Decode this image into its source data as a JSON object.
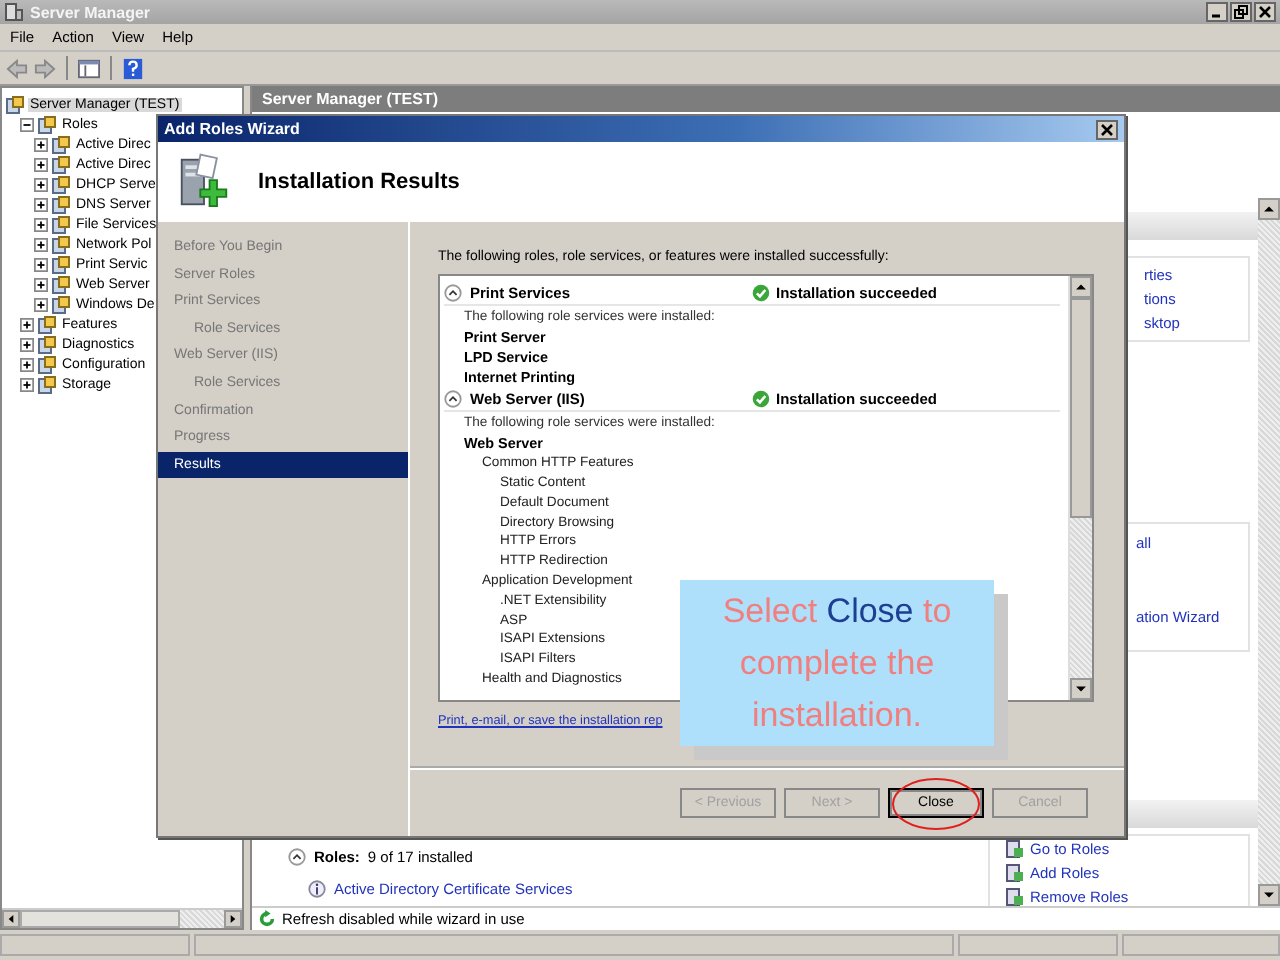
{
  "window": {
    "title": "Server Manager"
  },
  "menu": [
    "File",
    "Action",
    "View",
    "Help"
  ],
  "tree": [
    {
      "label": "Server Manager (TEST)",
      "selected": true,
      "children": [
        {
          "label": "Roles",
          "selected": false,
          "expanded": true,
          "children": [
            {
              "label": "Active Direc",
              "selected": false,
              "expanded": false
            },
            {
              "label": "Active Direc",
              "selected": false,
              "expanded": false
            },
            {
              "label": "DHCP Serve",
              "selected": false,
              "expanded": false
            },
            {
              "label": "DNS Server",
              "selected": false,
              "expanded": false
            },
            {
              "label": "File Services",
              "selected": false,
              "expanded": false
            },
            {
              "label": "Network Pol",
              "selected": false,
              "expanded": false
            },
            {
              "label": "Print Servic",
              "selected": false,
              "expanded": false
            },
            {
              "label": "Web Server",
              "selected": false,
              "expanded": false
            },
            {
              "label": "Windows De",
              "selected": false,
              "expanded": false
            }
          ]
        },
        {
          "label": "Features",
          "selected": false,
          "expanded": false
        },
        {
          "label": "Diagnostics",
          "selected": false,
          "expanded": false
        },
        {
          "label": "Configuration",
          "selected": false,
          "expanded": false
        },
        {
          "label": "Storage",
          "selected": false,
          "expanded": false
        }
      ]
    }
  ],
  "main_pane": {
    "header": "Server Manager (TEST)",
    "roles_summary": {
      "label": "Roles:",
      "value": "9 of 17 installed",
      "expanded": true
    },
    "role_link": "Active Directory Certificate Services",
    "tasks_upper": [
      "rties",
      "tions",
      "sktop"
    ],
    "tasks_middle": [
      "all",
      "ation Wizard"
    ],
    "tasks_lower": [
      "Go to Roles",
      "Add Roles",
      "Remove Roles"
    ],
    "status": "Refresh disabled while wizard in use"
  },
  "wizard": {
    "title": "Add Roles Wizard",
    "heading": "Installation Results",
    "steps": [
      {
        "label": "Before You Begin",
        "kind": "step",
        "selected": false
      },
      {
        "label": "Server Roles",
        "kind": "step",
        "selected": false
      },
      {
        "label": "Print Services",
        "kind": "step",
        "selected": false
      },
      {
        "label": "Role Services",
        "kind": "substep",
        "selected": false
      },
      {
        "label": "Web Server (IIS)",
        "kind": "step",
        "selected": false
      },
      {
        "label": "Role Services",
        "kind": "substep",
        "selected": false
      },
      {
        "label": "Confirmation",
        "kind": "step",
        "selected": false
      },
      {
        "label": "Progress",
        "kind": "step",
        "selected": false
      },
      {
        "label": "Results",
        "kind": "step",
        "selected": true
      }
    ],
    "intro": "The following roles, role services, or features were installed successfully:",
    "results": [
      {
        "title": "Print Services",
        "expanded": true,
        "status": "Installation succeeded",
        "description": "The following role services were installed:",
        "items": [
          {
            "label": "Print Server"
          },
          {
            "label": "LPD Service"
          },
          {
            "label": "Internet Printing"
          }
        ]
      },
      {
        "title": "Web Server (IIS)",
        "expanded": true,
        "status": "Installation succeeded",
        "description": "The following role services were installed:",
        "items": [
          {
            "label": "Web Server",
            "children": [
              {
                "label": "Common HTTP Features",
                "children": [
                  {
                    "label": "Static Content"
                  },
                  {
                    "label": "Default Document"
                  },
                  {
                    "label": "Directory Browsing"
                  },
                  {
                    "label": "HTTP Errors"
                  },
                  {
                    "label": "HTTP Redirection"
                  }
                ]
              },
              {
                "label": "Application Development",
                "children": [
                  {
                    "label": ".NET Extensibility"
                  },
                  {
                    "label": "ASP"
                  },
                  {
                    "label": "ISAPI Extensions"
                  },
                  {
                    "label": "ISAPI Filters"
                  }
                ]
              },
              {
                "label": "Health and Diagnostics"
              }
            ]
          }
        ]
      }
    ],
    "report_link": "Print, e-mail, or save the installation rep",
    "buttons": [
      {
        "label": "< Previous",
        "disabled": true,
        "default": false
      },
      {
        "label": "Next >",
        "disabled": true,
        "default": false
      },
      {
        "label": "Close",
        "disabled": false,
        "default": true
      },
      {
        "label": "Cancel",
        "disabled": true,
        "default": false
      }
    ]
  },
  "callout": {
    "parts": [
      {
        "text": "Select ",
        "highlight": false
      },
      {
        "text": "Close",
        "highlight": true
      },
      {
        "text": " to complete the installation.",
        "highlight": false
      }
    ]
  }
}
